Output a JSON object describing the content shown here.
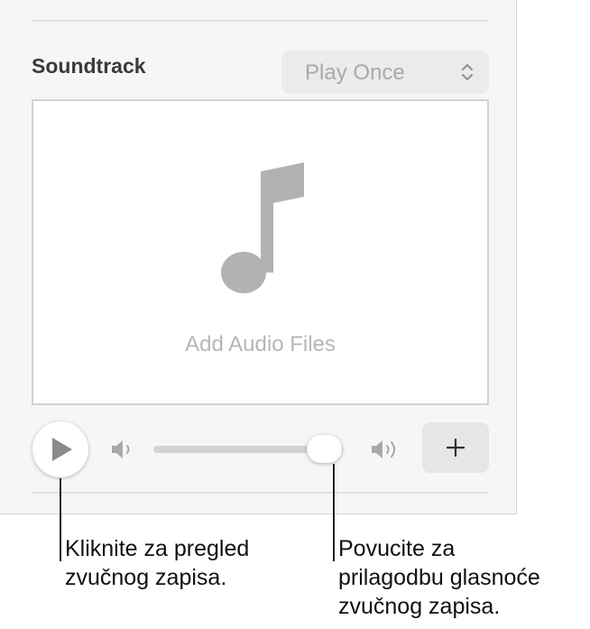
{
  "soundtrack": {
    "title": "Soundtrack",
    "playback_mode": "Play Once",
    "drop_zone_label": "Add Audio Files",
    "volume_level": 0.9
  },
  "icons": {
    "playback_menu": "chevron-up-down-icon",
    "drop_zone": "music-note-icon",
    "play": "play-icon",
    "volume_low": "speaker-low-icon",
    "volume_high": "speaker-high-icon",
    "add": "plus-icon"
  },
  "callouts": {
    "play": [
      "Kliknite za pregled",
      "zvučnog zapisa."
    ],
    "volume": [
      "Povucite za",
      "prilagodbu glasnoće",
      "zvučnog zapisa."
    ]
  }
}
